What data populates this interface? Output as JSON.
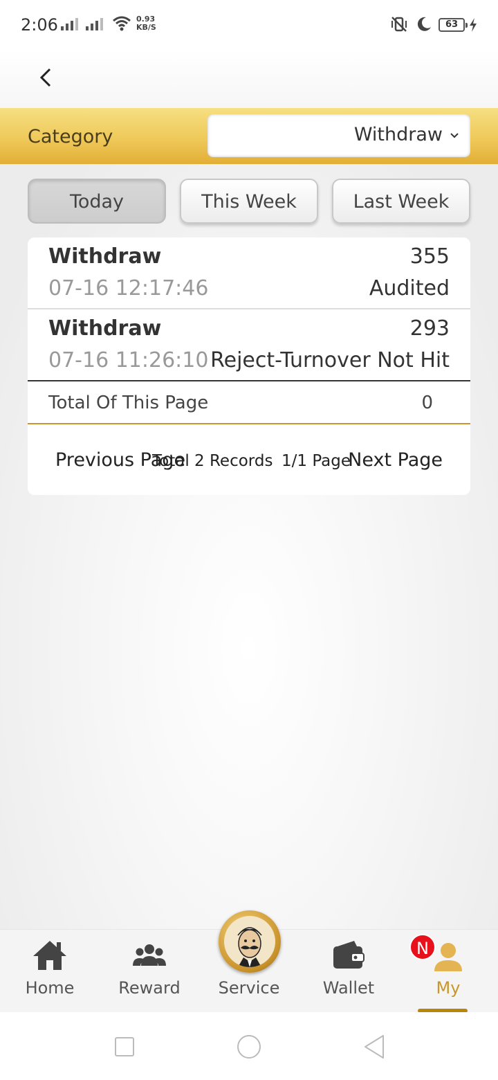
{
  "status_bar": {
    "time": "2:06",
    "net_speed_value": "0.93",
    "net_speed_unit": "KB/S",
    "battery": "63"
  },
  "header": {
    "back_icon": "chevron-left-icon"
  },
  "category": {
    "label": "Category",
    "selected": "Withdraw",
    "dropdown_icon": "chevron-down-icon"
  },
  "tabs": [
    {
      "label": "Today",
      "active": true
    },
    {
      "label": "This Week",
      "active": false
    },
    {
      "label": "Last Week",
      "active": false
    }
  ],
  "records": [
    {
      "type": "Withdraw",
      "amount": "355",
      "time": "07-16 12:17:46",
      "status": "Audited"
    },
    {
      "type": "Withdraw",
      "amount": "293",
      "time": "07-16 11:26:10",
      "status": "Reject-Turnover Not Hit"
    }
  ],
  "total": {
    "label": "Total Of This Page",
    "value": "0"
  },
  "pagination": {
    "prev": "Previous Page",
    "records": "Total 2 Records",
    "page_info": "1/1 Page",
    "next": "Next Page"
  },
  "bottom_nav": [
    {
      "label": "Home",
      "icon": "home-icon"
    },
    {
      "label": "Reward",
      "icon": "group-icon"
    },
    {
      "label": "Service",
      "icon": "service-avatar-icon"
    },
    {
      "label": "Wallet",
      "icon": "wallet-icon"
    },
    {
      "label": "My",
      "icon": "user-icon",
      "badge": "N",
      "active": true
    }
  ],
  "colors": {
    "accent": "#c8962a",
    "category_bar": "#efc95a",
    "badge": "#e8101a"
  }
}
